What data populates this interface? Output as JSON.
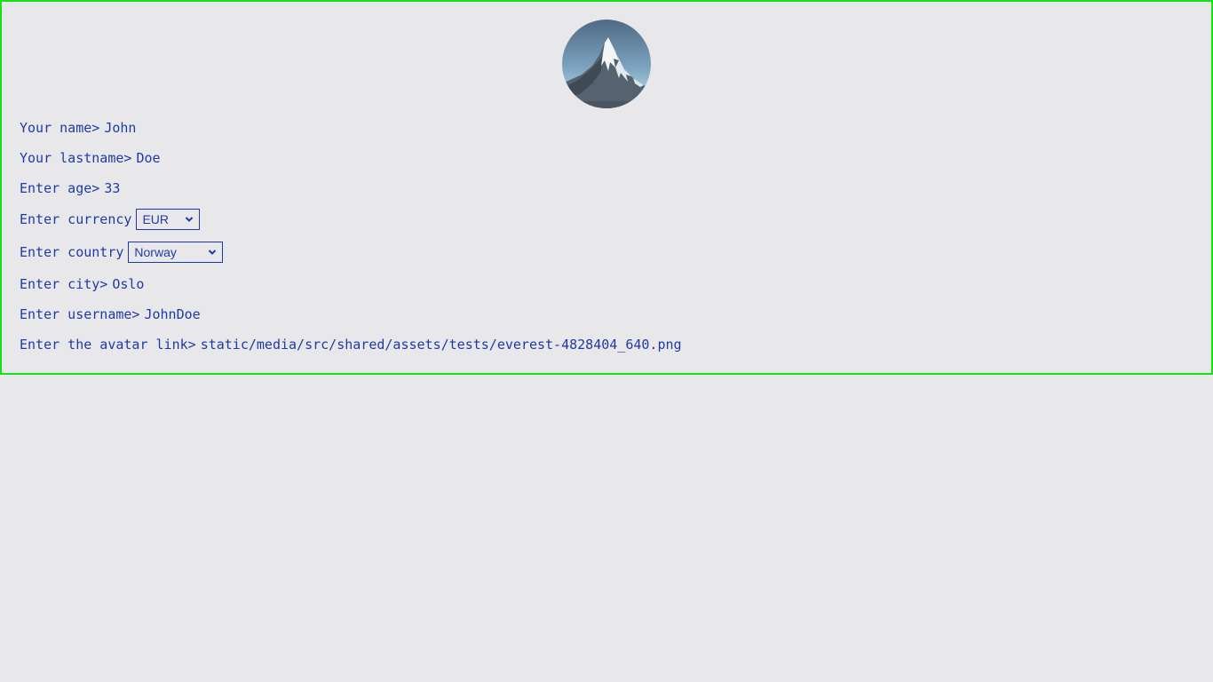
{
  "avatar": {
    "alt": "avatar",
    "icon": "mountain-peak-image"
  },
  "form": {
    "name": {
      "label": "Your name>",
      "value": "John"
    },
    "lastname": {
      "label": "Your lastname>",
      "value": "Doe"
    },
    "age": {
      "label": "Enter age>",
      "value": "33"
    },
    "currency": {
      "label": "Enter currency",
      "selected": "EUR"
    },
    "country": {
      "label": "Enter country",
      "selected": "Norway"
    },
    "city": {
      "label": "Enter city>",
      "value": "Oslo"
    },
    "username": {
      "label": "Enter username>",
      "value": "JohnDoe"
    },
    "avatar_link": {
      "label": "Enter the avatar link>",
      "value": "static/media/src/shared/assets/tests/everest-4828404_640.png"
    }
  },
  "colors": {
    "text": "#1f3aa8",
    "background": "#e8e8ea",
    "panel_border": "#16e016"
  }
}
